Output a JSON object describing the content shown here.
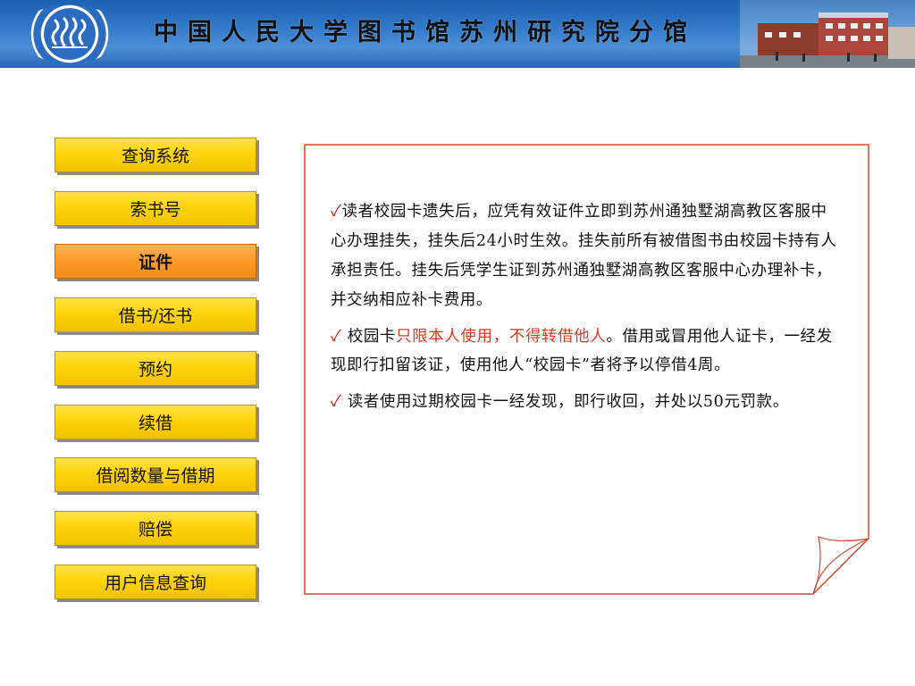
{
  "header": {
    "title": "中国人民大学图书馆苏州研究院分馆",
    "logo_name": "renmin-university-logo",
    "background_color": "#2f78c8"
  },
  "menu": {
    "items": [
      {
        "label": "查询系统",
        "active": false
      },
      {
        "label": "索书号",
        "active": false
      },
      {
        "label": "证件",
        "active": true
      },
      {
        "label": "借书/还书",
        "active": false
      },
      {
        "label": "预约",
        "active": false
      },
      {
        "label": "续借",
        "active": false
      },
      {
        "label": "借阅数量与借期",
        "active": false
      },
      {
        "label": "赔偿",
        "active": false
      },
      {
        "label": "用户信息查询",
        "active": false
      }
    ],
    "colors": {
      "normal": "#ffd40a",
      "active": "#ff9a2a"
    }
  },
  "content": {
    "bullet_icon": "checkmark-icon",
    "paragraphs": [
      {
        "check": "✓",
        "text": "读者校园卡遗失后，应凭有效证件立即到苏州通独墅湖高教区客服中心办理挂失，挂失后24小时生效。挂失前所有被借图书由校园卡持有人承担责任。挂失后凭学生证到苏州通独墅湖高教区客服中心办理补卡，并交纳相应补卡费用。"
      },
      {
        "check": "✓",
        "text_before": " 校园卡",
        "highlight": "只限本人使用，不得转借他人",
        "text_after": "。借用或冒用他人证卡，一经发现即行扣留该证，使用他人“校园卡”者将予以停借4周。"
      },
      {
        "check": "✓",
        "text": " 读者使用过期校园卡一经发现，即行收回，并处以50元罚款。"
      }
    ],
    "highlight_color": "#e03a1e",
    "border_color": "#d04a2a"
  }
}
